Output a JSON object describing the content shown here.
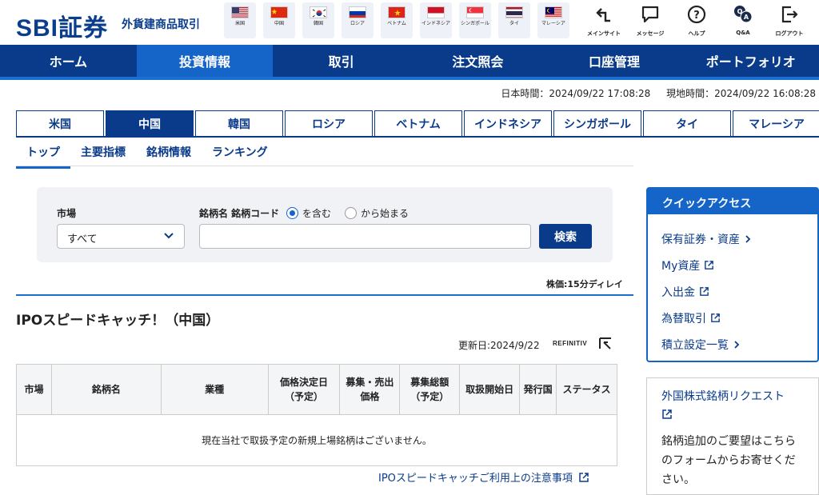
{
  "header": {
    "logo": "SBI証券",
    "subtitle": "外貨建商品取引",
    "flags": [
      {
        "label": "米国",
        "icon": "us-flag-icon"
      },
      {
        "label": "中国",
        "icon": "china-flag-icon"
      },
      {
        "label": "韓国",
        "icon": "korea-flag-icon"
      },
      {
        "label": "ロシア",
        "icon": "russia-flag-icon"
      },
      {
        "label": "ベトナム",
        "icon": "vietnam-flag-icon"
      },
      {
        "label": "インドネシア",
        "icon": "indonesia-flag-icon"
      },
      {
        "label": "シンガポール",
        "icon": "singapore-flag-icon"
      },
      {
        "label": "タイ",
        "icon": "thailand-flag-icon"
      },
      {
        "label": "マレーシア",
        "icon": "malaysia-flag-icon"
      }
    ],
    "icons": [
      {
        "label": "メインサイト",
        "icon": "return-icon"
      },
      {
        "label": "メッセージ",
        "icon": "message-icon"
      },
      {
        "label": "ヘルプ",
        "icon": "help-icon"
      },
      {
        "label": "Q&A",
        "icon": "qa-icon"
      },
      {
        "label": "ログアウト",
        "icon": "logout-icon"
      }
    ]
  },
  "mainnav": [
    "ホーム",
    "投資情報",
    "取引",
    "注文照会",
    "口座管理",
    "ポートフォリオ"
  ],
  "time": {
    "japan": "日本時間：2024/09/22 17:08:28",
    "local": "現地時間：2024/09/22 16:08:28"
  },
  "country_tabs": [
    "米国",
    "中国",
    "韓国",
    "ロシア",
    "ベトナム",
    "インドネシア",
    "シンガポール",
    "タイ",
    "マレーシア"
  ],
  "sub_tabs": [
    "トップ",
    "主要指標",
    "銘柄情報",
    "ランキング"
  ],
  "search": {
    "market_label": "市場",
    "market_value": "すべて",
    "name_label": "銘柄名 銘柄コード",
    "radio_contains": "を含む",
    "radio_starts": "から始まる",
    "button": "検索"
  },
  "delay_note": "株価:15分ディレイ",
  "ipo": {
    "title": "IPOスピードキャッチ！（中国）",
    "updated": "更新日:2024/9/22",
    "provider": "REFINITIV",
    "columns": [
      "市場",
      "銘柄名",
      "業種",
      "価格決定日\n（予定）",
      "募集・売出\n価格",
      "募集総額\n（予定）",
      "取扱開始日",
      "発行国",
      "ステータス"
    ],
    "empty_message": "現在当社で取扱予定の新規上場銘柄はございません。",
    "notice_link": "IPOスピードキャッチご利用上の注意事項"
  },
  "quick_access": {
    "title": "クイックアクセス",
    "items": [
      "保有証券・資産",
      "My資産",
      "入出金",
      "為替取引",
      "積立設定一覧"
    ]
  },
  "request": {
    "link": "外国株式銘柄リクエスト",
    "text": "銘柄追加のご要望はこちらのフォームからお寄せください。"
  },
  "colors": {
    "brand": "#0a3b8a",
    "accent": "#1565c8"
  }
}
